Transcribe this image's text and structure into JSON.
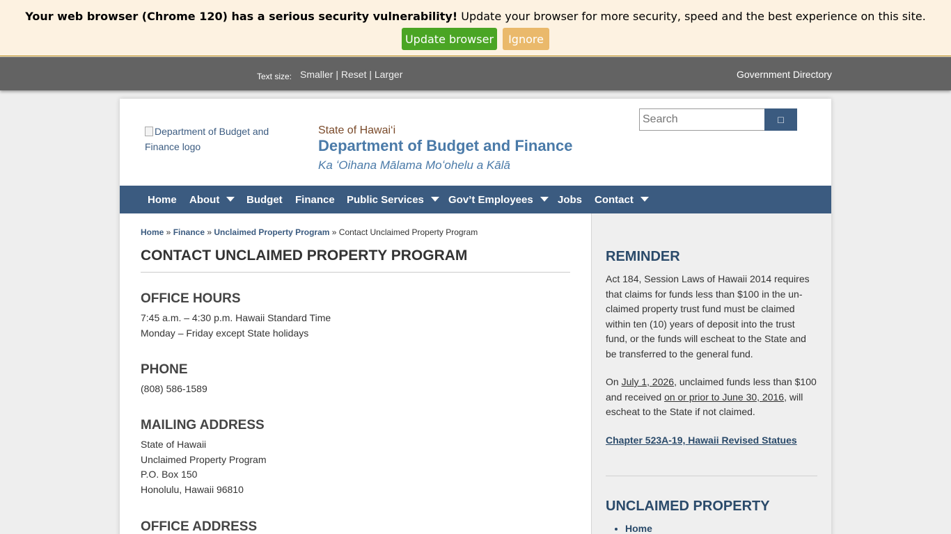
{
  "update_banner": {
    "message_bold": "Your web browser (Chrome 120) has a serious security vulnerability!",
    "message_rest": " Update your browser for more security, speed and the best experience on this site.",
    "update_label": "Update browser",
    "ignore_label": "Ignore"
  },
  "utility_bar": {
    "text_size_label": "Text size:",
    "smaller": "Smaller",
    "reset": "Reset",
    "larger": "Larger",
    "separator": " | ",
    "gov_directory": "Government Directory"
  },
  "header": {
    "logo_alt": "Department of Budget and Finance logo",
    "state": "State of Hawai‘i",
    "department": "Department of Budget and Finance",
    "hawaiian_name": "Ka ʻOihana Mālama Moʻohelu a Kālā",
    "search_placeholder": "Search",
    "search_icon": "search-icon"
  },
  "nav": {
    "items": [
      {
        "label": "Home"
      },
      {
        "label": "About"
      },
      {
        "label": "Budget"
      },
      {
        "label": "Finance"
      },
      {
        "label": "Public Services"
      },
      {
        "label": "Gov’t Employees"
      },
      {
        "label": "Jobs"
      },
      {
        "label": "Contact"
      }
    ]
  },
  "breadcrumb": {
    "items": [
      "Home",
      "Finance",
      "Unclaimed Property Program"
    ],
    "separator": " » ",
    "current": "Contact Unclaimed Property Program"
  },
  "main": {
    "title": "CONTACT UNCLAIMED PROPERTY PROGRAM",
    "office_hours": {
      "heading": "OFFICE HOURS",
      "line1": "7:45 a.m. – 4:30 p.m. Hawaii Standard Time",
      "line2": "Monday – Friday except State holidays"
    },
    "phone": {
      "heading": "PHONE",
      "number": "(808) 586-1589"
    },
    "mailing": {
      "heading": "MAILING ADDRESS",
      "line1": "State of Hawaii",
      "line2": "Unclaimed Property Program",
      "line3": "P.O. Box 150",
      "line4": "Honolulu, Hawaii 96810"
    },
    "office_address": {
      "heading": "OFFICE ADDRESS"
    }
  },
  "sidebar": {
    "reminder_heading": "REMINDER",
    "reminder_text": "Act 184, Session Laws of Hawaii 2014 requires that claims for funds less than $100 in the un-claimed property trust fund must be claimed within ten (10) years of deposit into the trust fund, or the funds will escheat to the State and be transferred to the general fund.",
    "p2_a": "On ",
    "p2_date1": "July 1, 2026",
    "p2_b": ", unclaimed funds less than $100 and received ",
    "p2_date2": "on or prior to June 30, 2016",
    "p2_c": ", will escheat to the State if not claimed.",
    "chapter_link": "Chapter 523A-19, Hawaii Revised Statues",
    "unclaimed_heading": "UNCLAIMED PROPERTY",
    "list": [
      "Home"
    ]
  }
}
